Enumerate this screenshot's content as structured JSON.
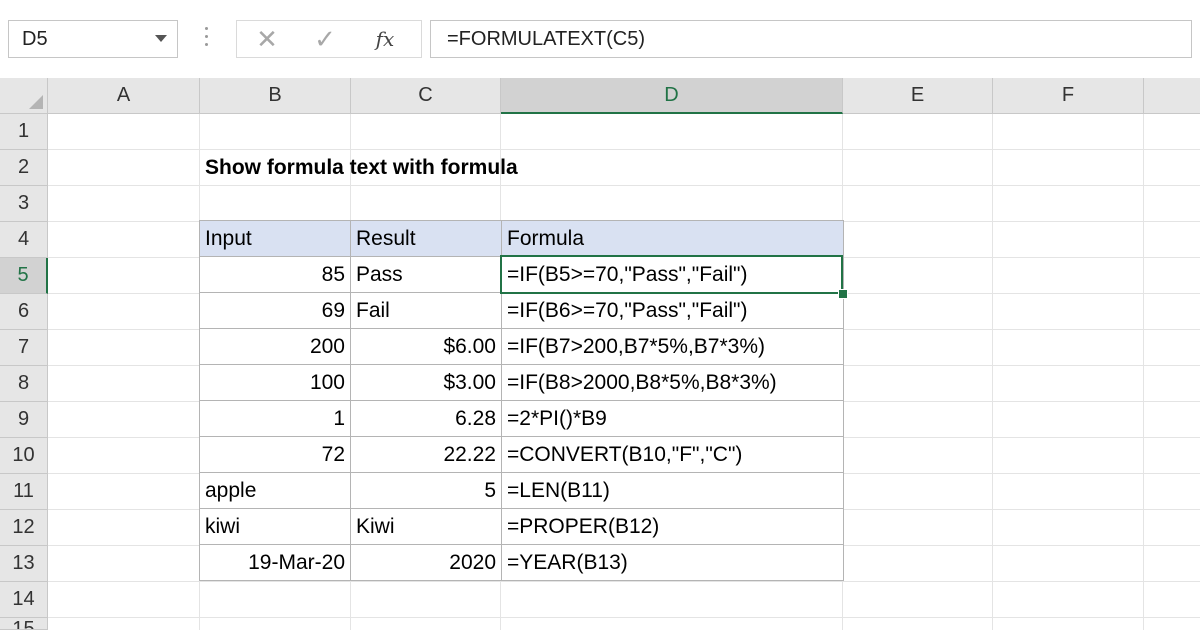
{
  "formula_bar": {
    "name_box": "D5",
    "cancel_icon": "✕",
    "enter_icon": "✓",
    "function_icon": "fx",
    "formula": "=FORMULATEXT(C5)"
  },
  "columns": [
    "A",
    "B",
    "C",
    "D",
    "E",
    "F"
  ],
  "selected_column": "D",
  "rows": [
    "1",
    "2",
    "3",
    "4",
    "5",
    "6",
    "7",
    "8",
    "9",
    "10",
    "11",
    "12",
    "13",
    "14",
    "15"
  ],
  "selected_row": "5",
  "sheet": {
    "title": "Show formula text with formula",
    "headers": [
      "Input",
      "Result",
      "Formula"
    ],
    "data": [
      {
        "input": "85",
        "result": "Pass",
        "formula": "=IF(B5>=70,\"Pass\",\"Fail\")"
      },
      {
        "input": "69",
        "result": "Fail",
        "formula": "=IF(B6>=70,\"Pass\",\"Fail\")"
      },
      {
        "input": "200",
        "result": "$6.00",
        "formula": "=IF(B7>200,B7*5%,B7*3%)"
      },
      {
        "input": "100",
        "result": "$3.00",
        "formula": "=IF(B8>2000,B8*5%,B8*3%)"
      },
      {
        "input": "1",
        "result": "6.28",
        "formula": "=2*PI()*B9"
      },
      {
        "input": "72",
        "result": "22.22",
        "formula": "=CONVERT(B10,\"F\",\"C\")"
      },
      {
        "input": "apple",
        "result": "5",
        "formula": "=LEN(B11)"
      },
      {
        "input": "kiwi",
        "result": "Kiwi",
        "formula": "=PROPER(B12)"
      },
      {
        "input": "19-Mar-20",
        "result": "2020",
        "formula": "=YEAR(B13)"
      }
    ]
  },
  "colors": {
    "accent": "#217346",
    "header_fill": "#d9e1f2"
  }
}
